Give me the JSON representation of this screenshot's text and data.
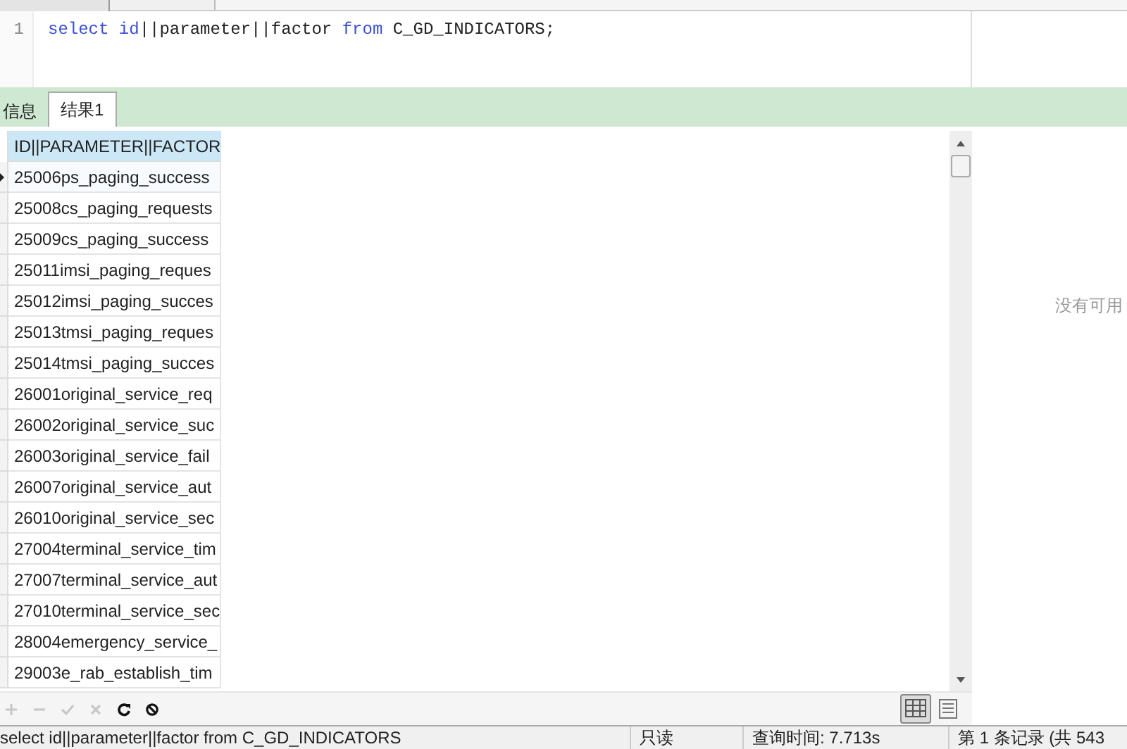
{
  "editor": {
    "line_numbers": [
      "1"
    ],
    "sql": [
      {
        "kind": "keyword",
        "text": "select id"
      },
      {
        "kind": "plain",
        "text": "||parameter||factor "
      },
      {
        "kind": "keyword",
        "text": "from"
      },
      {
        "kind": "plain",
        "text": " C_GD_INDICATORS;"
      }
    ]
  },
  "result_tabs": [
    {
      "label": "信息",
      "selected": false
    },
    {
      "label": "结果1",
      "selected": true
    }
  ],
  "grid": {
    "columns": [
      "ID||PARAMETER||FACTOR"
    ],
    "rows": [
      {
        "cells": [
          "25006ps_paging_success"
        ],
        "selected": true
      },
      {
        "cells": [
          "25008cs_paging_requests"
        ],
        "selected": false
      },
      {
        "cells": [
          "25009cs_paging_success"
        ],
        "selected": false
      },
      {
        "cells": [
          "25011imsi_paging_reques"
        ],
        "selected": false
      },
      {
        "cells": [
          "25012imsi_paging_succes"
        ],
        "selected": false
      },
      {
        "cells": [
          "25013tmsi_paging_reques"
        ],
        "selected": false
      },
      {
        "cells": [
          "25014tmsi_paging_succes"
        ],
        "selected": false
      },
      {
        "cells": [
          "26001original_service_req"
        ],
        "selected": false
      },
      {
        "cells": [
          "26002original_service_suc"
        ],
        "selected": false
      },
      {
        "cells": [
          "26003original_service_fail"
        ],
        "selected": false
      },
      {
        "cells": [
          "26007original_service_aut"
        ],
        "selected": false
      },
      {
        "cells": [
          "26010original_service_sec"
        ],
        "selected": false
      },
      {
        "cells": [
          "27004terminal_service_tim"
        ],
        "selected": false
      },
      {
        "cells": [
          "27007terminal_service_aut"
        ],
        "selected": false
      },
      {
        "cells": [
          "27010terminal_service_sec"
        ],
        "selected": false
      },
      {
        "cells": [
          "28004emergency_service_"
        ],
        "selected": false
      },
      {
        "cells": [
          "29003e_rab_establish_tim"
        ],
        "selected": false
      }
    ]
  },
  "side_panel": {
    "message": "没有可用"
  },
  "toolbar": [
    {
      "kind": "add",
      "disabled": true
    },
    {
      "kind": "remove",
      "disabled": true
    },
    {
      "kind": "apply",
      "disabled": true
    },
    {
      "kind": "cancel",
      "disabled": true
    },
    {
      "kind": "refresh",
      "disabled": false
    },
    {
      "kind": "stop",
      "disabled": false
    }
  ],
  "view_toggle": [
    {
      "kind": "grid",
      "selected": true
    },
    {
      "kind": "form",
      "selected": false
    }
  ],
  "status_bar": {
    "query": "select id||parameter||factor from C_GD_INDICATORS",
    "mode": "只读",
    "query_time": "查询时间: 7.713s",
    "record": "第 1 条记录 (共 543"
  }
}
